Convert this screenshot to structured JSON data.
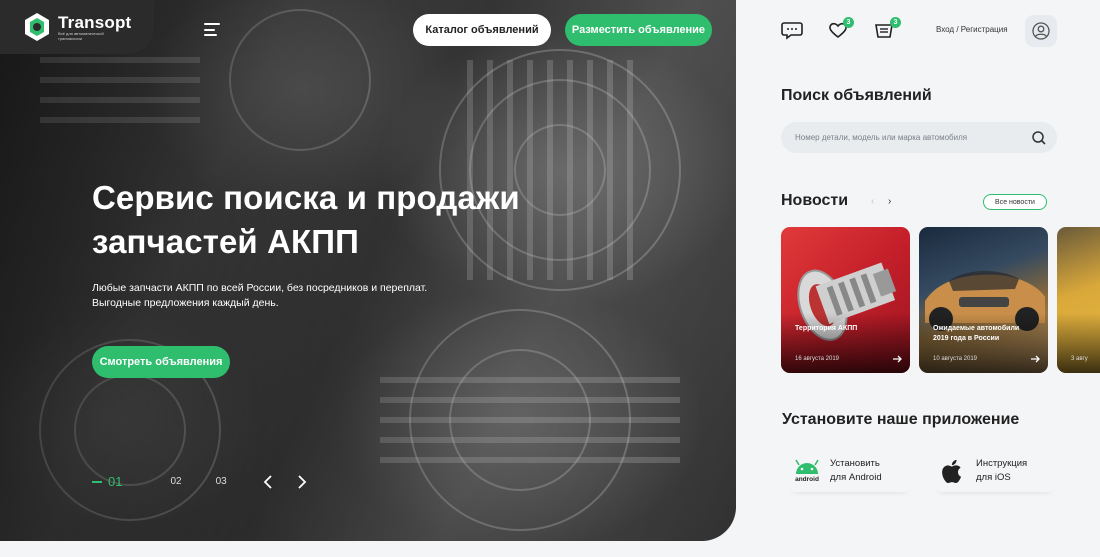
{
  "brand": {
    "name": "Transopt",
    "tagline": "Всё для автоматической трансмиссии"
  },
  "header": {
    "catalog_label": "Каталог объявлений",
    "post_label": "Разместить объявление",
    "login_label": "Вход / Регистрация",
    "favorites_count": "3",
    "cart_count": "3"
  },
  "hero": {
    "title": "Сервис поиска и продажи запчастей АКПП",
    "desc_line1": "Любые запчасти АКПП по всей России, без посредников и переплат.",
    "desc_line2": "Выгодные предложения каждый день.",
    "cta_label": "Смотреть объявления",
    "slides": [
      "01",
      "02",
      "03"
    ]
  },
  "search": {
    "title": "Поиск объявлений",
    "placeholder": "Номер детали, модель или марка автомобиля"
  },
  "news": {
    "title": "Новости",
    "all_label": "Все новости",
    "items": [
      {
        "title": "Территория АКПП",
        "date": "16 августа 2019"
      },
      {
        "title": "Ожидаемые автомобили 2019 года в России",
        "date": "10 августа 2019"
      },
      {
        "title": "",
        "date": "3 авгу"
      }
    ]
  },
  "app": {
    "title": "Установите наше приложение",
    "android_label_1": "Установить",
    "android_label_2": "для Android",
    "android_word": "android",
    "ios_label_1": "Инструкция",
    "ios_label_2": "для iOS"
  },
  "colors": {
    "accent": "#2fbd6e",
    "dark": "#2b2b2b",
    "bg": "#f4f5f7"
  }
}
